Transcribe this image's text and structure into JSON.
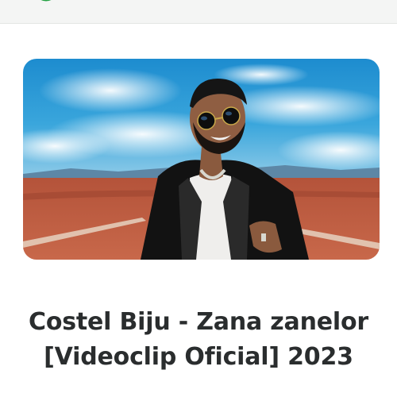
{
  "header": {
    "app_icon": "whatsapp-icon",
    "background_color": "#f4f5f4",
    "accent_color": "#25a244"
  },
  "video": {
    "thumbnail_icon": "video-thumbnail",
    "title_line1": "Costel Biju - Zana zanelor",
    "title_line2": "[Videoclip Oficial] 2023"
  }
}
